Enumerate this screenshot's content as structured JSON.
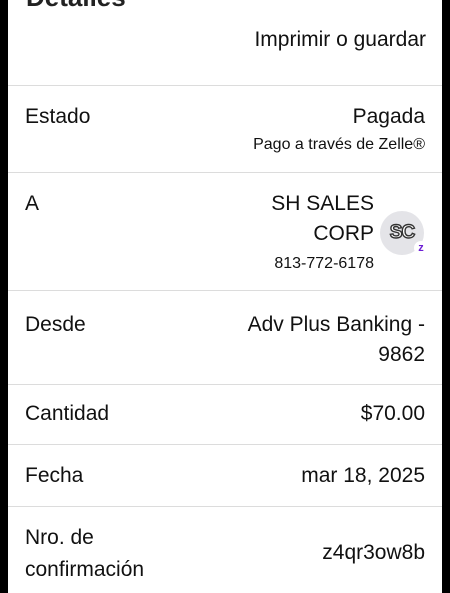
{
  "header": {
    "title": "Detalles",
    "print_label": "Imprimir o guardar"
  },
  "estado": {
    "label": "Estado",
    "value": "Pagada",
    "sub": "Pago a través de Zelle®"
  },
  "a": {
    "label": "A",
    "name_line1": "SH SALES",
    "name_line2": "CORP",
    "phone": "813-772-6178",
    "avatar_initials": "SC",
    "badge_icon": "zelle-z-icon"
  },
  "desde": {
    "label": "Desde",
    "value_line1": "Adv Plus Banking -",
    "value_line2": "9862"
  },
  "cantidad": {
    "label": "Cantidad",
    "value": "$70.00"
  },
  "fecha": {
    "label": "Fecha",
    "value": "mar 18, 2025"
  },
  "confirmacion": {
    "label_line1": "Nro. de",
    "label_line2": "confirmación",
    "value": "z4qr3ow8b"
  },
  "colors": {
    "background": "#ffffff",
    "text": "#111111",
    "divider": "#dcdcdc",
    "zelle_purple": "#6d1ed4",
    "frame": "#000000"
  }
}
